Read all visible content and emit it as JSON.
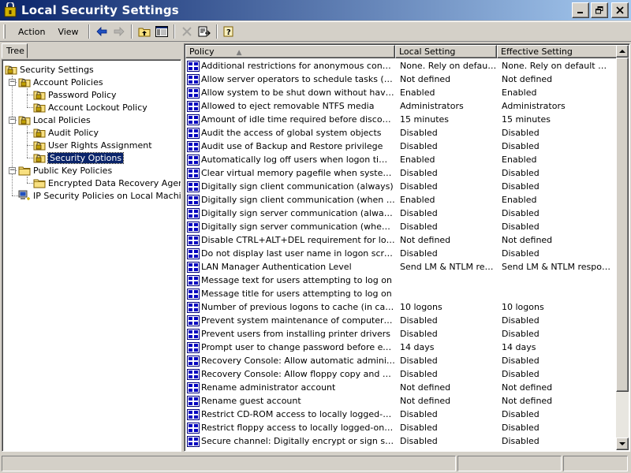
{
  "window": {
    "title": "Local Security Settings",
    "title_color_start": "#0a246a",
    "title_color_end": "#a6caf0"
  },
  "menu": {
    "action": "Action",
    "view": "View"
  },
  "tree_tab": "Tree",
  "tree": {
    "root": "Security Settings",
    "account_policies": "Account Policies",
    "password_policy": "Password Policy",
    "account_lockout_policy": "Account Lockout Policy",
    "local_policies": "Local Policies",
    "audit_policy": "Audit Policy",
    "user_rights_assignment": "User Rights Assignment",
    "security_options": "Security Options",
    "public_key_policies": "Public Key Policies",
    "encrypted_data_recovery_agents": "Encrypted Data Recovery Agents",
    "ip_security_policies": "IP Security Policies on Local Machine"
  },
  "columns": {
    "policy": "Policy",
    "local_setting": "Local Setting",
    "effective_setting": "Effective Setting"
  },
  "rows": [
    {
      "policy": "Additional restrictions for anonymous connections",
      "local": "None. Rely on default...",
      "effective": "None. Rely on default per..."
    },
    {
      "policy": "Allow server operators to schedule tasks (domai...",
      "local": "Not defined",
      "effective": "Not defined"
    },
    {
      "policy": "Allow system to be shut down without having to ...",
      "local": "Enabled",
      "effective": "Enabled"
    },
    {
      "policy": "Allowed to eject removable NTFS media",
      "local": "Administrators",
      "effective": "Administrators"
    },
    {
      "policy": "Amount of idle time required before disconnectin...",
      "local": "15 minutes",
      "effective": "15 minutes"
    },
    {
      "policy": "Audit the access of global system objects",
      "local": "Disabled",
      "effective": "Disabled"
    },
    {
      "policy": "Audit use of Backup and Restore privilege",
      "local": "Disabled",
      "effective": "Disabled"
    },
    {
      "policy": "Automatically log off users when logon time expi...",
      "local": "Enabled",
      "effective": "Enabled"
    },
    {
      "policy": "Clear virtual memory pagefile when system shut...",
      "local": "Disabled",
      "effective": "Disabled"
    },
    {
      "policy": "Digitally sign client communication (always)",
      "local": "Disabled",
      "effective": "Disabled"
    },
    {
      "policy": "Digitally sign client communication (when possible)",
      "local": "Enabled",
      "effective": "Enabled"
    },
    {
      "policy": "Digitally sign server communication (always)",
      "local": "Disabled",
      "effective": "Disabled"
    },
    {
      "policy": "Digitally sign server communication (when possible)",
      "local": "Disabled",
      "effective": "Disabled"
    },
    {
      "policy": "Disable CTRL+ALT+DEL requirement for logon",
      "local": "Not defined",
      "effective": "Not defined"
    },
    {
      "policy": "Do not display last user name in logon screen",
      "local": "Disabled",
      "effective": "Disabled"
    },
    {
      "policy": "LAN Manager Authentication Level",
      "local": "Send LM & NTLM resp...",
      "effective": "Send LM & NTLM responses"
    },
    {
      "policy": "Message text for users attempting to log on",
      "local": "",
      "effective": ""
    },
    {
      "policy": "Message title for users attempting to log on",
      "local": "",
      "effective": ""
    },
    {
      "policy": "Number of previous logons to cache (in case do...",
      "local": "10 logons",
      "effective": "10 logons"
    },
    {
      "policy": "Prevent system maintenance of computer accou...",
      "local": "Disabled",
      "effective": "Disabled"
    },
    {
      "policy": "Prevent users from installing printer drivers",
      "local": "Disabled",
      "effective": "Disabled"
    },
    {
      "policy": "Prompt user to change password before expiration",
      "local": "14 days",
      "effective": "14 days"
    },
    {
      "policy": "Recovery Console: Allow automatic administrativ...",
      "local": "Disabled",
      "effective": "Disabled"
    },
    {
      "policy": "Recovery Console: Allow floppy copy and acces...",
      "local": "Disabled",
      "effective": "Disabled"
    },
    {
      "policy": "Rename administrator account",
      "local": "Not defined",
      "effective": "Not defined"
    },
    {
      "policy": "Rename guest account",
      "local": "Not defined",
      "effective": "Not defined"
    },
    {
      "policy": "Restrict CD-ROM access to locally logged-on use...",
      "local": "Disabled",
      "effective": "Disabled"
    },
    {
      "policy": "Restrict floppy access to locally logged-on user ...",
      "local": "Disabled",
      "effective": "Disabled"
    },
    {
      "policy": "Secure channel: Digitally encrypt or sign secure ...",
      "local": "Disabled",
      "effective": "Disabled"
    }
  ]
}
